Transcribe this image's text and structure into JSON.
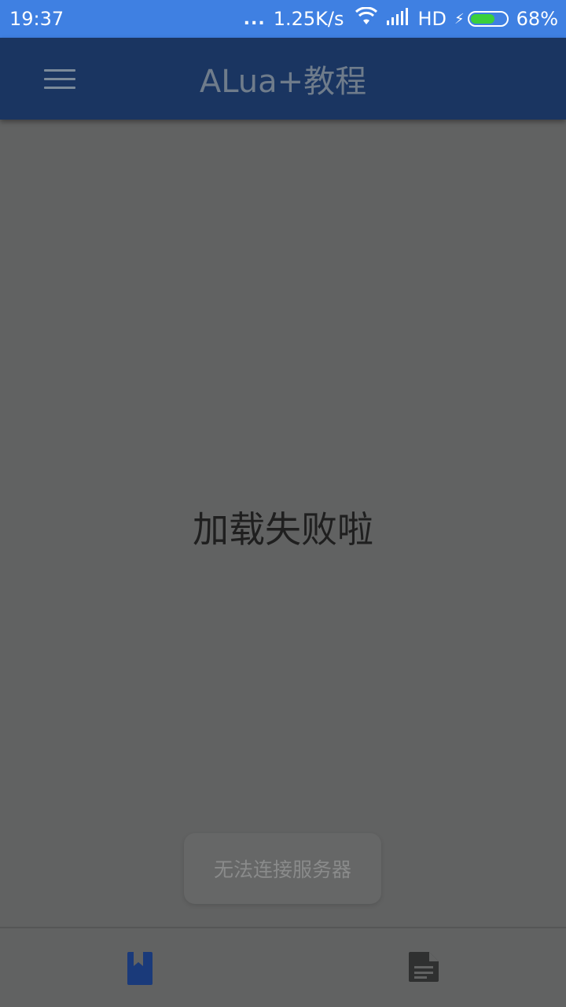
{
  "status_bar": {
    "time": "19:37",
    "dots": "...",
    "net_speed": "1.25K/s",
    "network": "HD",
    "battery_percent": "68%",
    "battery_level": 0.68
  },
  "app_bar": {
    "title": "ALua+教程",
    "menu_icon": "hamburger-menu-icon"
  },
  "content": {
    "error_message": "加载失败啦"
  },
  "toast": {
    "message": "无法连接服务器"
  },
  "bottom_nav": {
    "items": [
      {
        "icon": "bookmark-book-icon",
        "active": true,
        "color": "#1a3a7a"
      },
      {
        "icon": "document-icon",
        "active": false,
        "color": "#2f3030"
      }
    ]
  }
}
